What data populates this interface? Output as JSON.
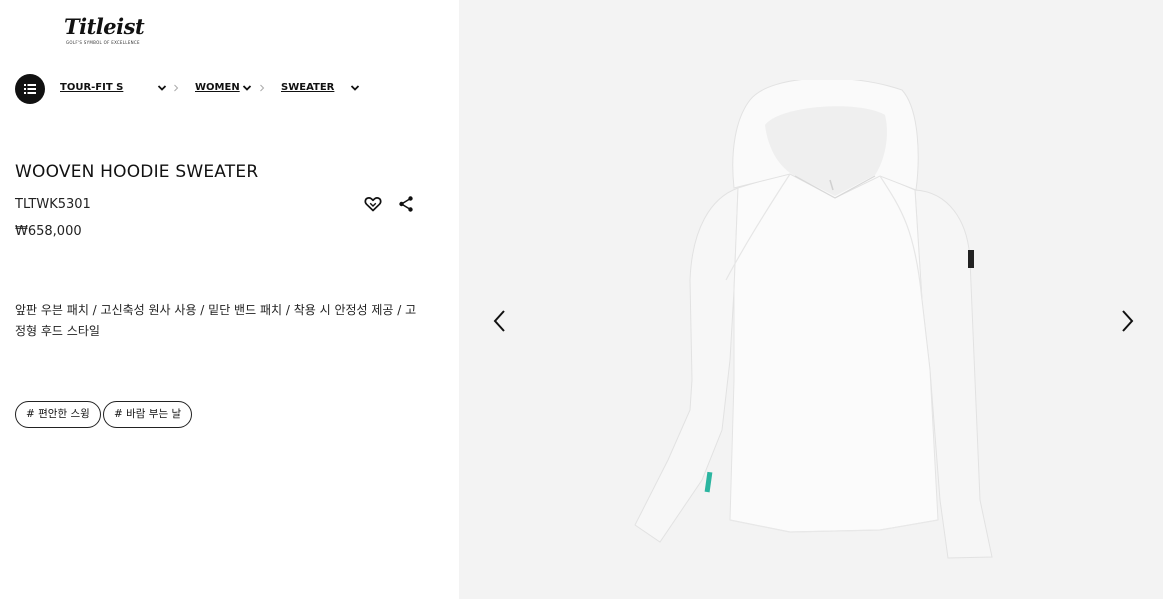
{
  "brand": {
    "logo_text": "Titleist",
    "tagline": "GOLF'S SYMBOL OF EXCELLENCE"
  },
  "breadcrumb": {
    "items": [
      {
        "label": "TOUR-FIT S"
      },
      {
        "label": "WOMEN"
      },
      {
        "label": "SWEATER"
      }
    ]
  },
  "product": {
    "name": "WOOVEN HOODIE SWEATER",
    "code": "TLTWK5301",
    "price": "₩658,000",
    "description": "앞판 우븐 패치 / 고신축성 원사 사용 / 밑단 밴드 패치 / 착용 시 안정성 제공 / 고정형 후드 스타일",
    "tags": [
      "# 편안한 스윙",
      "# 바람 부는 날"
    ]
  },
  "icons": {
    "menu": "list-icon",
    "wishlist": "heart-icon",
    "share": "share-icon",
    "prev": "chevron-left-icon",
    "next": "chevron-right-icon"
  },
  "colors": {
    "text": "#111111",
    "gallery_bg": "#f3f3f3",
    "garment": "#ffffff",
    "accent_trim": "#2bb5a0"
  }
}
